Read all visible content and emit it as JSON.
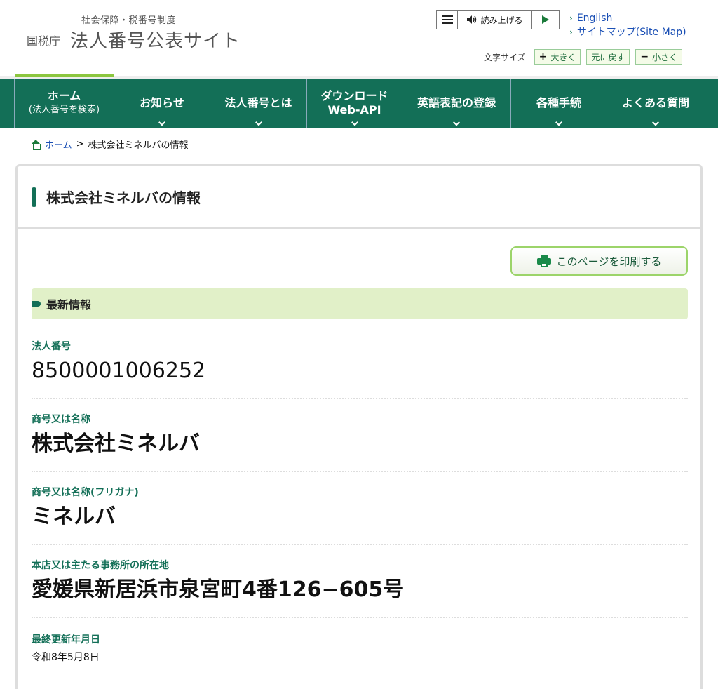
{
  "header": {
    "subtitle": "社会保障・税番号制度",
    "agency": "国税庁",
    "site_name": "法人番号公表サイト",
    "read_aloud_label": "読み上げる",
    "links": [
      "English",
      "サイトマップ(Site Map)"
    ],
    "font_size_label": "文字サイズ",
    "font_size_buttons": [
      {
        "symbol": "+",
        "label": "大きく"
      },
      {
        "symbol": "",
        "label": "元に戻す"
      },
      {
        "symbol": "−",
        "label": "小さく"
      }
    ]
  },
  "nav": {
    "items": [
      {
        "line1": "ホーム",
        "line2": "(法人番号を検索)"
      },
      {
        "line1": "お知らせ",
        "line2": ""
      },
      {
        "line1": "法人番号とは",
        "line2": ""
      },
      {
        "line1": "ダウンロード",
        "line2": "Web-API"
      },
      {
        "line1": "英語表記の登録",
        "line2": ""
      },
      {
        "line1": "各種手続",
        "line2": ""
      },
      {
        "line1": "よくある質問",
        "line2": ""
      }
    ]
  },
  "breadcrumb": {
    "home": "ホーム",
    "separator": ">",
    "current": "株式会社ミネルバの情報"
  },
  "page": {
    "title": "株式会社ミネルバの情報",
    "print_button": "このページを印刷する",
    "section_title": "最新情報",
    "fields": [
      {
        "label": "法人番号",
        "value": "8500001006252"
      },
      {
        "label": "商号又は名称",
        "value": "株式会社ミネルバ"
      },
      {
        "label": "商号又は名称(フリガナ)",
        "value": "ミネルバ"
      },
      {
        "label": "本店又は主たる事務所の所在地",
        "value": "愛媛県新居浜市泉宮町4番126−605号"
      },
      {
        "label": "最終更新年月日",
        "value": "令和8年5月8日"
      }
    ]
  },
  "colors": {
    "nav_bg": "#136f57",
    "accent_green": "#8cc63f",
    "section_band": "#e1f0c8",
    "link_blue": "#1a4fb5"
  }
}
